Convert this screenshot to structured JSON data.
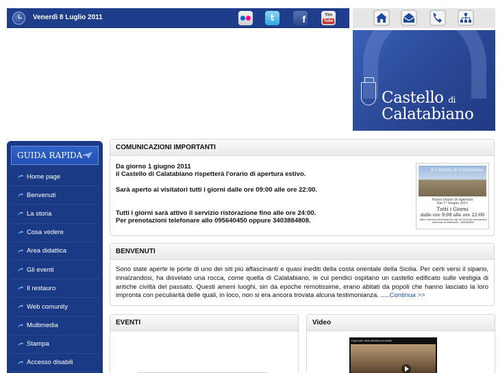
{
  "header": {
    "date": "Venerdì 8 Luglio 2011",
    "social": [
      {
        "name": "flickr-icon"
      },
      {
        "name": "twitter-icon",
        "glyph": "t"
      },
      {
        "name": "facebook-icon",
        "glyph": "f"
      },
      {
        "name": "youtube-icon",
        "text1": "You",
        "text2": "Tube"
      }
    ],
    "nav_icons": [
      "home-icon",
      "mail-icon",
      "phone-icon",
      "sitemap-icon"
    ],
    "colors": {
      "bar": "#1e3d8a",
      "sidebar": "#1b3a86",
      "accent": "#2250b4"
    }
  },
  "banner": {
    "line1": "Castello",
    "line1_small": "di",
    "line2": "Calatabiano"
  },
  "sidebar": {
    "title": "GUIDA RAPIDA",
    "items": [
      {
        "label": "Home page"
      },
      {
        "label": "Benvenuti"
      },
      {
        "label": "La storia"
      },
      {
        "label": "Cosa vedere"
      },
      {
        "label": "Area didattica"
      },
      {
        "label": "Gli eventi"
      },
      {
        "label": "Il restauro"
      },
      {
        "label": "Web comunity"
      },
      {
        "label": "Multimedia"
      },
      {
        "label": "Stampa"
      },
      {
        "label": "Accesso disabili"
      }
    ]
  },
  "comunicazioni": {
    "title": "COMUNICAZIONI IMPORTANTI",
    "p1_line1": "Da giorno 1 giugno 2011",
    "p1_line2": "il Castello di Calatabiano rispetterà l'orario di apertura estivo.",
    "p2": "Sarà aperto ai visitatori tutti i giorni dalle ore 09:00 alle ore 22:00.",
    "p3_line1": "Tutti i giorni sarà attivo il servizio ristorazione fino alle ore 24:00.",
    "p3_line2": "Per prenotazioni telefonare allo 095640450 oppure 3403884808.",
    "flyer": {
      "img_caption": "Il Castello di Calatabiano",
      "heading": "Nuovo Orario Di Apertura",
      "subheading": "Dal 1° Giugno 2011",
      "line1": "Tutti i Giorni",
      "line2": "dalle ore 9:00 alle ore 22:00",
      "small": "attivo il servizio ristorazione fino alle ore 24:00 per prenotazioni telefonare al 095640450 - 3403884808"
    }
  },
  "benvenuti": {
    "title": "BENVENUTI",
    "text": "Sono state aperte le porte di uno dei siti più affascinanti e quasi inediti della costa orientale della Sicilia. Per certi versi il sipario, innalzandosi, ha disvelato una rocca, come quella di Calatabiano, le cui pendici ospitano un castello edificato sulle vestigia di antiche civiltà del passato. Questi ameni luoghi, sin da epoche remotissime, erano abitati da popoli che hanno lasciato la loro impronta con peculiarità delle quali, in loco, non si era ancora trovata alcuna testimonianza. .....",
    "more": "Continua >>"
  },
  "eventi": {
    "title": "EVENTI"
  },
  "video": {
    "title": "Video",
    "caption": "Il giornale della didattica museale"
  }
}
